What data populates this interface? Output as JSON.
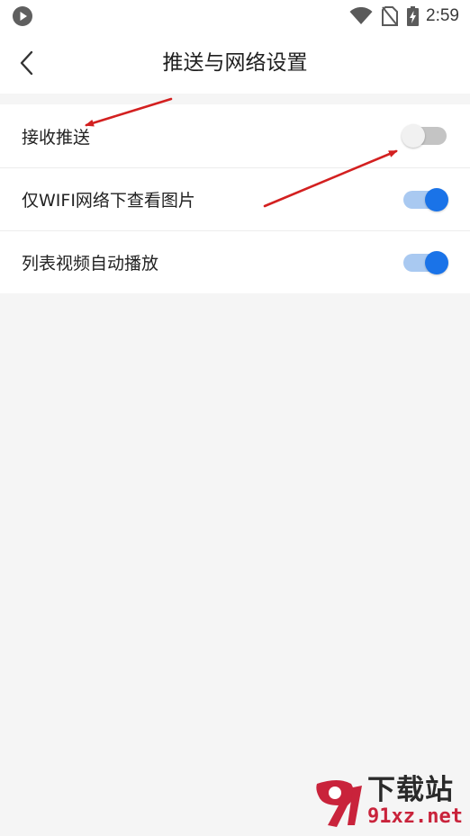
{
  "status_bar": {
    "time": "2:59",
    "icons": [
      "play-circle-icon",
      "wifi-icon",
      "no-sim-icon",
      "battery-charging-icon"
    ]
  },
  "header": {
    "title": "推送与网络设置",
    "back_icon": "chevron-left-icon"
  },
  "settings": [
    {
      "label": "接收推送",
      "enabled": false
    },
    {
      "label": "仅WIFI网络下查看图片",
      "enabled": true
    },
    {
      "label": "列表视频自动播放",
      "enabled": true
    }
  ],
  "watermark": {
    "cn": "下载站",
    "en": "91xz.net"
  },
  "colors": {
    "accent": "#1a73e8",
    "track_on": "#a9c9f1",
    "track_off": "#c4c4c4",
    "annotation_arrow": "#d32020",
    "background": "#f5f5f5"
  }
}
